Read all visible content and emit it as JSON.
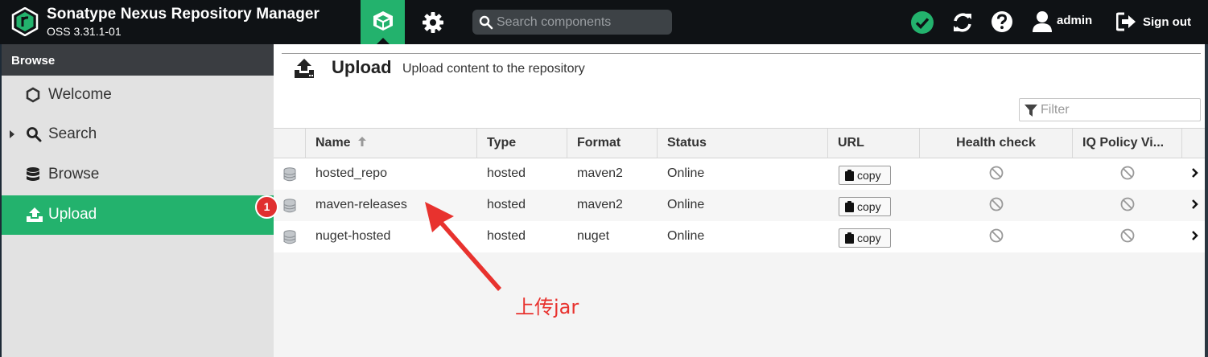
{
  "app": {
    "title": "Sonatype Nexus Repository Manager",
    "version": "OSS 3.31.1-01"
  },
  "header": {
    "search_placeholder": "Search components",
    "username": "admin",
    "signout_label": "Sign out",
    "status_color": "#23b26d"
  },
  "sidebar": {
    "heading": "Browse",
    "items": [
      {
        "label": "Welcome",
        "icon": "hexagon-icon"
      },
      {
        "label": "Search",
        "icon": "search-icon"
      },
      {
        "label": "Browse",
        "icon": "database-icon"
      },
      {
        "label": "Upload",
        "icon": "upload-icon",
        "active": true
      }
    ]
  },
  "main": {
    "title": "Upload",
    "subtitle": "Upload content to the repository",
    "filter_placeholder": "Filter",
    "columns": [
      "Name",
      "Type",
      "Format",
      "Status",
      "URL",
      "Health check",
      "IQ Policy Vi..."
    ],
    "copy_label": "copy",
    "rows": [
      {
        "name": "hosted_repo",
        "type": "hosted",
        "format": "maven2",
        "status": "Online"
      },
      {
        "name": "maven-releases",
        "type": "hosted",
        "format": "maven2",
        "status": "Online"
      },
      {
        "name": "nuget-hosted",
        "type": "hosted",
        "format": "nuget",
        "status": "Online"
      }
    ]
  },
  "annotation": {
    "badge": "1",
    "text": "上传jar",
    "color": "#e8322e"
  },
  "colors": {
    "accent": "#23b26d",
    "header_bg": "#0f1215"
  }
}
